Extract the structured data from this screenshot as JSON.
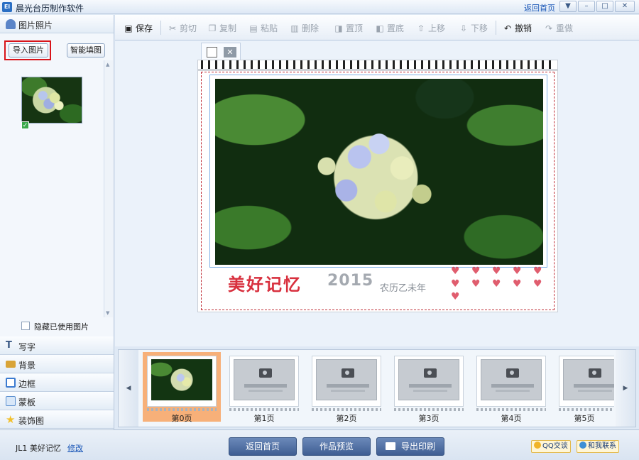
{
  "window": {
    "title": "晨光台历制作软件",
    "home_link": "返回首页",
    "controls": [
      "▼",
      "–",
      "□",
      "✕"
    ]
  },
  "left_panel": {
    "photos_section": "图片照片",
    "import_button": "导入图片",
    "smart_button": "智能填图",
    "hide_used_label": "隐藏已使用图片",
    "sections": [
      {
        "label": "写字",
        "icon": "text-icon",
        "color": "#3b5a86"
      },
      {
        "label": "背景",
        "icon": "background-icon",
        "color": "#d9a437"
      },
      {
        "label": "边框",
        "icon": "border-icon",
        "color": "#3c7bd0"
      },
      {
        "label": "蒙板",
        "icon": "mask-icon",
        "color": "#5a8fcf"
      },
      {
        "label": "装饰图",
        "icon": "star-icon",
        "color": "#f2c02c"
      }
    ]
  },
  "toolbar": {
    "save": "保存",
    "cut": "剪切",
    "copy": "复制",
    "paste": "粘贴",
    "delete": "删除",
    "to_top": "置顶",
    "to_bottom": "置底",
    "move_up": "上移",
    "move_down": "下移",
    "undo": "撤销",
    "redo": "重做"
  },
  "canvas": {
    "title_text": "美好记忆",
    "year": "2015",
    "subtitle": "农历乙未年",
    "hearts": "♥ ♥ ♥ ♥ ♥ ♥ ♥ ♥ ♥ ♥ ♥"
  },
  "filmstrip": {
    "pages": [
      {
        "label": "第0页",
        "selected": true,
        "flower": true
      },
      {
        "label": "第1页",
        "selected": false,
        "flower": false
      },
      {
        "label": "第2页",
        "selected": false,
        "flower": false
      },
      {
        "label": "第3页",
        "selected": false,
        "flower": false
      },
      {
        "label": "第4页",
        "selected": false,
        "flower": false
      },
      {
        "label": "第5页",
        "selected": false,
        "flower": false
      }
    ]
  },
  "bottom_bar": {
    "project_name": "JL1 美好记忆",
    "edit_link": "修改",
    "back_home": "返回首页",
    "preview": "作品预览",
    "export_print": "导出印刷",
    "qq_chat": "QQ交谈",
    "contact_us": "和我联系"
  },
  "colors": {
    "accent": "#3f5e93",
    "selected_page": "#f7b079",
    "highlight_border": "#d8141a"
  }
}
